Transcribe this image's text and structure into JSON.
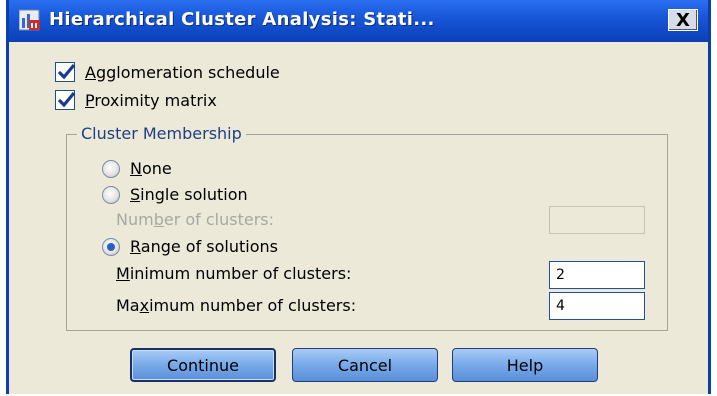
{
  "window": {
    "title": "Hierarchical Cluster Analysis: Stati...",
    "close_label": "X"
  },
  "checkboxes": [
    {
      "pre": "",
      "mnemonic": "A",
      "post": "gglomeration schedule",
      "checked": true
    },
    {
      "pre": "",
      "mnemonic": "P",
      "post": "roximity matrix",
      "checked": true
    }
  ],
  "cluster_membership": {
    "title": "Cluster Membership",
    "options": [
      {
        "pre": "",
        "mnemonic": "N",
        "post": "one",
        "selected": false
      },
      {
        "pre": "",
        "mnemonic": "S",
        "post": "ingle solution",
        "selected": false
      },
      {
        "pre": "",
        "mnemonic": "R",
        "post": "ange of solutions",
        "selected": true
      }
    ],
    "number_of_clusters": {
      "pre": "Num",
      "mnemonic": "b",
      "post": "er of clusters:",
      "value": "",
      "disabled": true
    },
    "minimum": {
      "pre": "",
      "mnemonic": "M",
      "post": "inimum number of clusters:",
      "value": "2"
    },
    "maximum": {
      "pre": "Ma",
      "mnemonic": "x",
      "post": "imum number of clusters:",
      "value": "4"
    }
  },
  "buttons": {
    "continue_label": "Continue",
    "cancel_label": "Cancel",
    "help_label": "Help"
  },
  "colors": {
    "titlebar": "#1755d6",
    "dialog_bg": "#ece9d8",
    "button_fill": "#78a9e9",
    "group_title": "#1f3f80"
  }
}
